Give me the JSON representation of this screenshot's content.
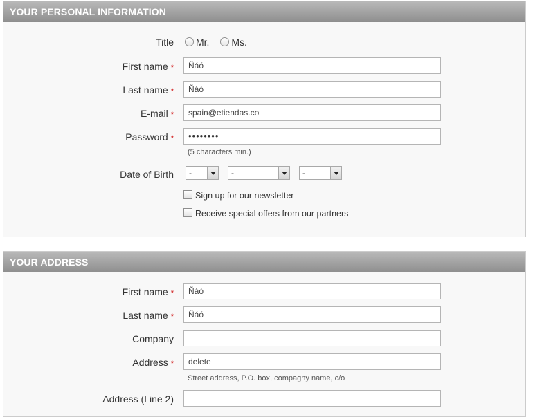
{
  "personal": {
    "header": "YOUR PERSONAL INFORMATION",
    "title_label": "Title",
    "title_options": [
      "Mr.",
      "Ms."
    ],
    "first_name_label": "First name",
    "first_name_value": "Ñáó",
    "last_name_label": "Last name",
    "last_name_value": "Ñáó",
    "email_label": "E-mail",
    "email_value": "spain@etiendas.co",
    "password_label": "Password",
    "password_value": "••••••••",
    "password_hint": "(5 characters min.)",
    "dob_label": "Date of Birth",
    "dob_day": "-",
    "dob_month": "-",
    "dob_year": "-",
    "newsletter_label": "Sign up for our newsletter",
    "offers_label": "Receive special offers from our partners",
    "required_mark": "*"
  },
  "address": {
    "header": "YOUR ADDRESS",
    "first_name_label": "First name",
    "first_name_value": "Ñáó",
    "last_name_label": "Last name",
    "last_name_value": "Ñáó",
    "company_label": "Company",
    "company_value": "",
    "address_label": "Address",
    "address_value": "delete",
    "address_hint": "Street address, P.O. box, compagny name, c/o",
    "address2_label": "Address (Line 2)",
    "address2_value": ""
  },
  "colors": {
    "header_gradient_top": "#b9b9b9",
    "header_gradient_bottom": "#8e8e8e",
    "required": "#cc0000",
    "panel_bg": "#f8f8f8"
  }
}
